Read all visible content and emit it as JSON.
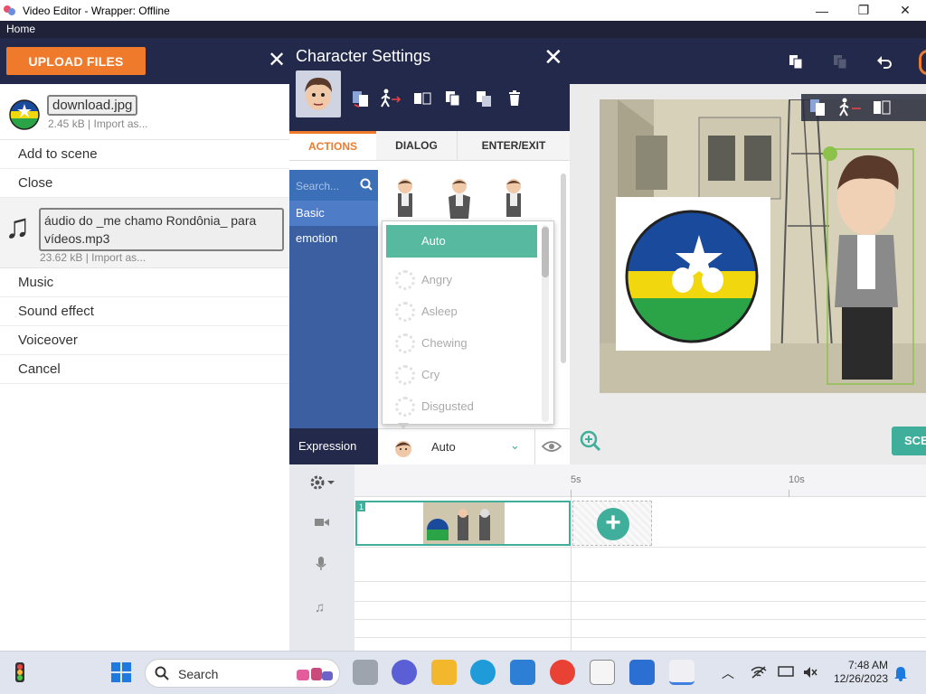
{
  "window": {
    "title": "Video Editor - Wrapper: Offline"
  },
  "menu": {
    "home": "Home"
  },
  "toolbar": {
    "upload_label": "UPLOAD FILES"
  },
  "files": {
    "image": {
      "name": "download.jpg",
      "meta": "2.45 kB | Import as...",
      "icon": "rondonia-ball-thumb"
    },
    "image_menu": [
      "Add to scene",
      "Close"
    ],
    "audio": {
      "name": "áudio do _me chamo Rondônia_ para vídeos.mp3",
      "meta": "23.62 kB | Import as...",
      "icon": "music-note-icon"
    },
    "audio_menu": [
      "Music",
      "Sound effect",
      "Voiceover",
      "Cancel"
    ]
  },
  "character_settings": {
    "title": "Character Settings",
    "tabs": [
      "ACTIONS",
      "DIALOG",
      "ENTER/EXIT"
    ],
    "active_tab": "ACTIONS",
    "search_placeholder": "Search...",
    "categories": [
      "Basic",
      "emotion"
    ],
    "expression_label": "Expression",
    "expression_value": "Auto"
  },
  "expression_dropdown": {
    "selected": "Auto",
    "options": [
      "Angry",
      "Asleep",
      "Chewing",
      "Cry",
      "Disgusted"
    ]
  },
  "stage": {
    "scene_button": "SCE"
  },
  "timeline": {
    "ticks": [
      "5s",
      "10s"
    ],
    "clip_number": "1"
  },
  "taskbar": {
    "search_label": "Search",
    "time": "7:48 AM",
    "date": "12/26/2023"
  },
  "colors": {
    "accent_orange": "#f07a2c",
    "teal": "#3fae9b",
    "navy": "#23294a",
    "category_blue": "#3b5fa0"
  }
}
